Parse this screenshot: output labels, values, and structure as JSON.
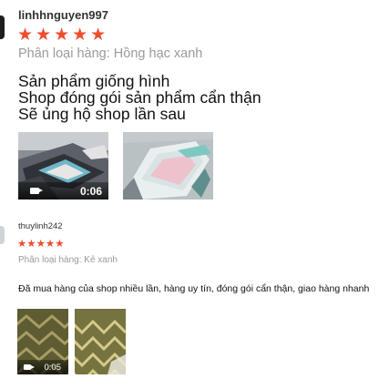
{
  "reviews": [
    {
      "username": "linhhnguyen997",
      "stars": "★★★★★",
      "variation": "Phân loại hàng: Hồng hạc xanh",
      "comment": [
        "Sản phẩm giống hình",
        "Shop đóng gói sản phẩm cẩn thận",
        "Sẽ ủng hộ shop lần sau"
      ],
      "video_duration": "0:06",
      "rating": 5
    },
    {
      "username": "thuylinh242",
      "stars": "★★★★★",
      "variation": "Phân loại hàng: Kẻ xanh",
      "comment": "Đã mua hàng của shop nhiều lần, hàng uy tín, đóng gói cẩn thận, giao hàng nhanh",
      "video_duration": "0:05",
      "rating": 5
    }
  ],
  "colors": {
    "star": "#ee4d2d",
    "variation_text": "#9a9a9a",
    "username": "#333333"
  },
  "icons": [
    "video-camera-icon"
  ]
}
